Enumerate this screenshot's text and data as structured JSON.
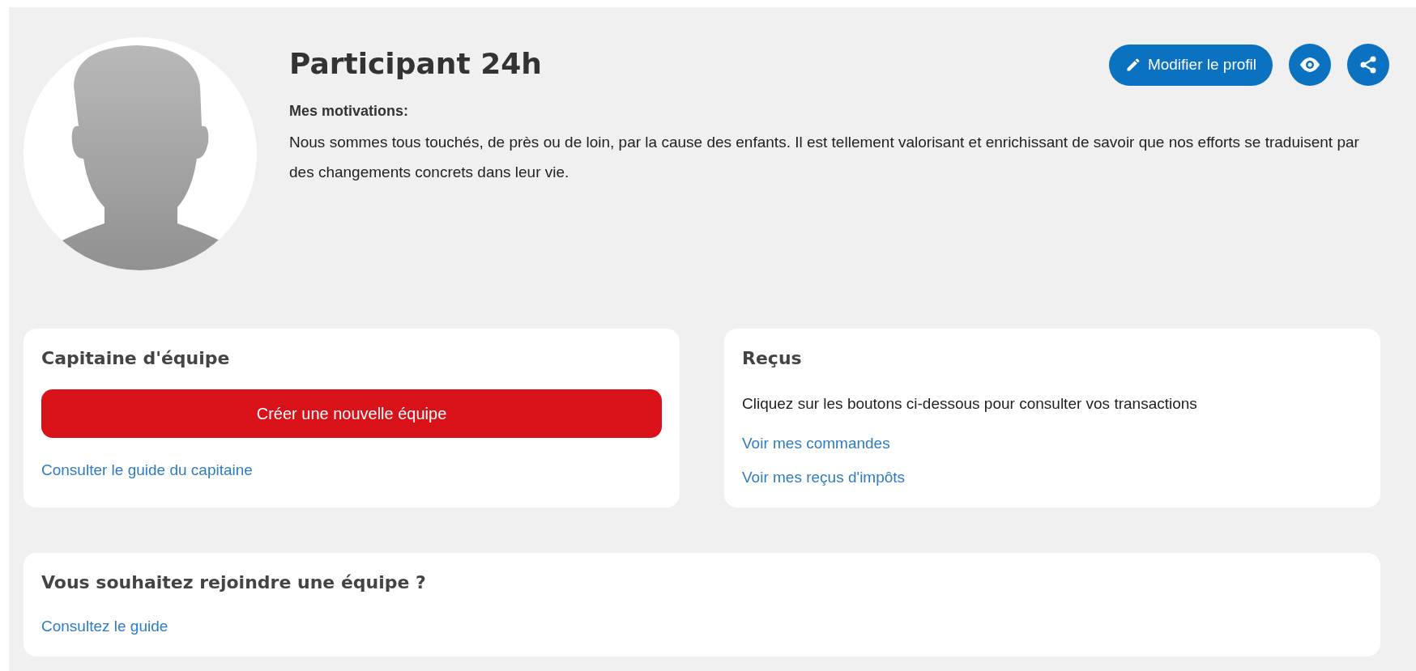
{
  "profile": {
    "name": "Participant 24h",
    "motivations_label": "Mes motivations:",
    "motivations_text": "Nous sommes tous touchés, de près ou de loin, par la cause des enfants. Il est tellement valorisant et enrichissant de savoir que nos efforts se traduisent par des changements concrets dans leur vie."
  },
  "actions": {
    "edit_label": "Modifier le profil"
  },
  "captain_card": {
    "title": "Capitaine d'équipe",
    "create_button": "Créer une nouvelle équipe",
    "guide_link": "Consulter le guide du capitaine"
  },
  "receipts_card": {
    "title": "Reçus",
    "description": "Cliquez sur les boutons ci-dessous pour consulter vos transactions",
    "links": [
      "Voir mes commandes",
      "Voir mes reçus d'impôts"
    ]
  },
  "join_card": {
    "title": "Vous souhaitez rejoindre une équipe ?",
    "guide_link": "Consultez le guide"
  }
}
